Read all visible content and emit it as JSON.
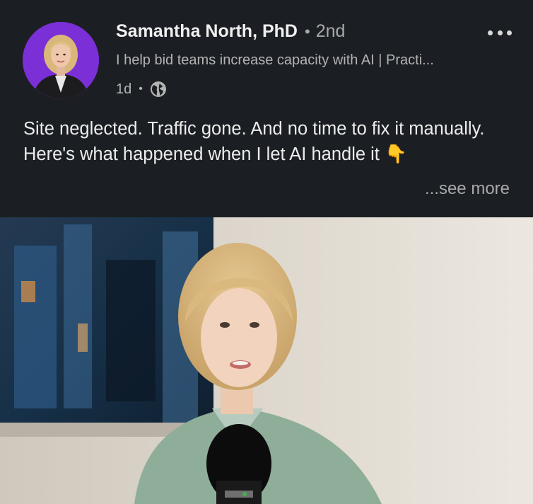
{
  "post": {
    "author_name": "Samantha North, PhD",
    "degree_separator": "•",
    "connection_degree": "2nd",
    "headline": "I help bid teams increase capacity with AI | Practi...",
    "time_ago": "1d",
    "meta_separator": "•",
    "visibility_icon": "globe-icon",
    "more_icon": "more-options-icon",
    "text": "Site neglected. Traffic gone. And no time to fix it manually.  Here's what happened when I let AI handle it 👇",
    "see_more_label": "...see more",
    "avatar_background": "#7b2fd6"
  }
}
